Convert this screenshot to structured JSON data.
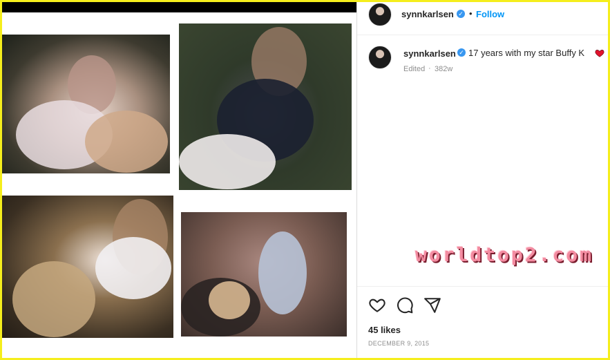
{
  "post": {
    "username": "synnkarlsen",
    "dot": "•",
    "follow_label": "Follow",
    "caption_text": "17 years with my star Buffy K",
    "edited_label": "Edited",
    "age_label": "382w",
    "likes_label": "45 likes",
    "date_label": "DECEMBER 9, 2015"
  },
  "watermark": "worldtop2.com",
  "icons": {
    "verified": "verified-badge-icon",
    "heart_emoji": "red-heart-emoji-icon",
    "like": "heart-outline-icon",
    "comment": "comment-bubble-icon",
    "share": "paper-plane-icon"
  },
  "colors": {
    "accent": "#0095f6",
    "border": "#f5ee1c",
    "heart": "#e0132c",
    "watermark": "#f38ca1"
  }
}
